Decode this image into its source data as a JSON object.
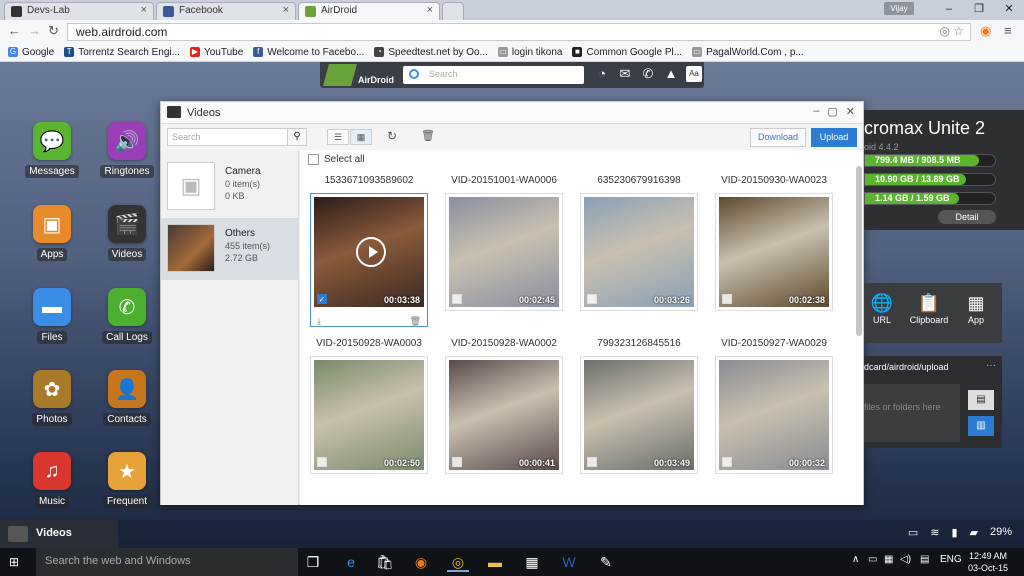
{
  "browser": {
    "tabs": [
      {
        "title": "Devs-Lab",
        "icon": "github-icon",
        "color": "#333333"
      },
      {
        "title": "Facebook",
        "icon": "facebook-icon",
        "color": "#3b5998"
      },
      {
        "title": "AirDroid",
        "icon": "airdroid-icon",
        "color": "#6aa23b"
      }
    ],
    "user": "Vijay",
    "url": "web.airdroid.com",
    "bookmarks": [
      {
        "label": "Google",
        "color": "#4285f4",
        "glyph": "G"
      },
      {
        "label": "Torrentz Search Engi...",
        "color": "#1a4f8f",
        "glyph": "T"
      },
      {
        "label": "YouTube",
        "color": "#e62117",
        "glyph": "▶"
      },
      {
        "label": "Welcome to Facebo...",
        "color": "#3b5998",
        "glyph": "f"
      },
      {
        "label": "Speedtest.net by Oo...",
        "color": "#444444",
        "glyph": "◔"
      },
      {
        "label": "login tikona",
        "color": "#999999",
        "glyph": "▭"
      },
      {
        "label": "Common Google Pl...",
        "color": "#222222",
        "glyph": "■"
      },
      {
        "label": "PagalWorld.Com , p...",
        "color": "#999999",
        "glyph": "▭"
      }
    ]
  },
  "airdroid": {
    "name": "AirDroid",
    "search_placeholder": "Search"
  },
  "desktop_icons": [
    {
      "label": "Messages",
      "color": "#5cb531",
      "glyph": "💬"
    },
    {
      "label": "Ringtones",
      "color": "#9a3fb8",
      "glyph": "🔊"
    },
    {
      "label": "Apps",
      "color": "#e88a2a",
      "glyph": "▣"
    },
    {
      "label": "Videos",
      "color": "#333333",
      "glyph": "🎬"
    },
    {
      "label": "Files",
      "color": "#3a8ee6",
      "glyph": "▬"
    },
    {
      "label": "Call Logs",
      "color": "#4caf2f",
      "glyph": "✆"
    },
    {
      "label": "Photos",
      "color": "#a87a2a",
      "glyph": "✿"
    },
    {
      "label": "Contacts",
      "color": "#c8761e",
      "glyph": "👤"
    },
    {
      "label": "Music",
      "color": "#d8362e",
      "glyph": "♫"
    },
    {
      "label": "Frequent",
      "color": "#e8a23a",
      "glyph": "★"
    }
  ],
  "videos_window": {
    "title": "Videos",
    "search_placeholder": "Search",
    "download_label": "Download",
    "upload_label": "Upload",
    "select_all_label": "Select all",
    "categories": [
      {
        "name": "Camera",
        "count": "0 item(s)",
        "size": "0 KB"
      },
      {
        "name": "Others",
        "count": "455 item(s)",
        "size": "2.72 GB"
      }
    ],
    "videos": [
      {
        "name": "1533671093589602",
        "duration": "00:03:38",
        "selected": true,
        "tone": "#4a3a32"
      },
      {
        "name": "VID-20151001-WA0006",
        "duration": "00:02:45",
        "selected": false,
        "tone": "#8a8fa0"
      },
      {
        "name": "635230679916398",
        "duration": "00:03:26",
        "selected": false,
        "tone": "#8aa0b6"
      },
      {
        "name": "VID-20150930-WA0023",
        "duration": "00:02:38",
        "selected": false,
        "tone": "#5e4a2e"
      },
      {
        "name": "VID-20150928-WA0003",
        "duration": "00:02:50",
        "selected": false,
        "tone": "#7a8a6a"
      },
      {
        "name": "VID-20150928-WA0002",
        "duration": "00:00:41",
        "selected": false,
        "tone": "#5a4a4a"
      },
      {
        "name": "799323126845516",
        "duration": "00:03:49",
        "selected": false,
        "tone": "#6a6e6a"
      },
      {
        "name": "VID-20150927-WA0029",
        "duration": "00:00:32",
        "selected": false,
        "tone": "#8a8c92"
      }
    ]
  },
  "device": {
    "name": "cromax Unite 2",
    "os": "oid 4.4.2",
    "storage": [
      {
        "text": "799.4 MB / 908.5 MB",
        "fraction": 0.88
      },
      {
        "text": "10.90 GB / 13.89 GB",
        "fraction": 0.78
      },
      {
        "text": "1.14 GB / 1.59 GB",
        "fraction": 0.72
      }
    ],
    "detail_label": "Detail"
  },
  "tools": [
    {
      "label": "URL",
      "icon": "globe-icon",
      "glyph": "🌐"
    },
    {
      "label": "Clipboard",
      "icon": "clipboard-icon",
      "glyph": "📋"
    },
    {
      "label": "App",
      "icon": "app-icon",
      "glyph": "▦"
    }
  ],
  "upload_panel": {
    "path": "dcard/airdroid/upload",
    "drop_text": "files or folders here"
  },
  "strip": {
    "videos_label": "Videos",
    "battery": "29%"
  },
  "taskbar": {
    "search_placeholder": "Search the web and Windows",
    "language": "ENG",
    "time": "12:49 AM",
    "date": "03-Oct-15"
  }
}
